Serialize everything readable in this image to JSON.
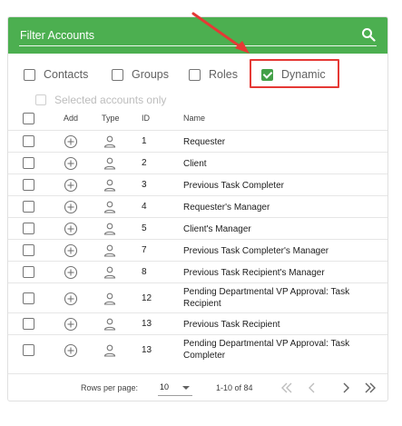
{
  "search": {
    "placeholder": "Filter Accounts"
  },
  "filters": [
    {
      "label": "Contacts",
      "checked": false
    },
    {
      "label": "Groups",
      "checked": false
    },
    {
      "label": "Roles",
      "checked": false
    },
    {
      "label": "Dynamic",
      "checked": true
    }
  ],
  "selected_only": {
    "label": "Selected accounts only",
    "enabled": false
  },
  "columns": {
    "add": "Add",
    "type": "Type",
    "id": "ID",
    "name": "Name"
  },
  "rows": [
    {
      "id": "1",
      "name": "Requester"
    },
    {
      "id": "2",
      "name": "Client"
    },
    {
      "id": "3",
      "name": "Previous Task Completer"
    },
    {
      "id": "4",
      "name": "Requester's Manager"
    },
    {
      "id": "5",
      "name": "Client's Manager"
    },
    {
      "id": "7",
      "name": "Previous Task Completer's Manager"
    },
    {
      "id": "8",
      "name": "Previous Task Recipient's Manager"
    },
    {
      "id": "12",
      "name": "Pending Departmental VP Approval: Task Recipient"
    },
    {
      "id": "13",
      "name": "Previous Task Recipient"
    },
    {
      "id": "13",
      "name": "Pending Departmental VP Approval: Task Completer"
    }
  ],
  "pagination": {
    "rows_per_page_label": "Rows per page:",
    "rows_per_page": "10",
    "range": "1-10 of 84"
  },
  "colors": {
    "header": "#4caf50",
    "checked": "#43a047",
    "highlight": "#e53935"
  }
}
